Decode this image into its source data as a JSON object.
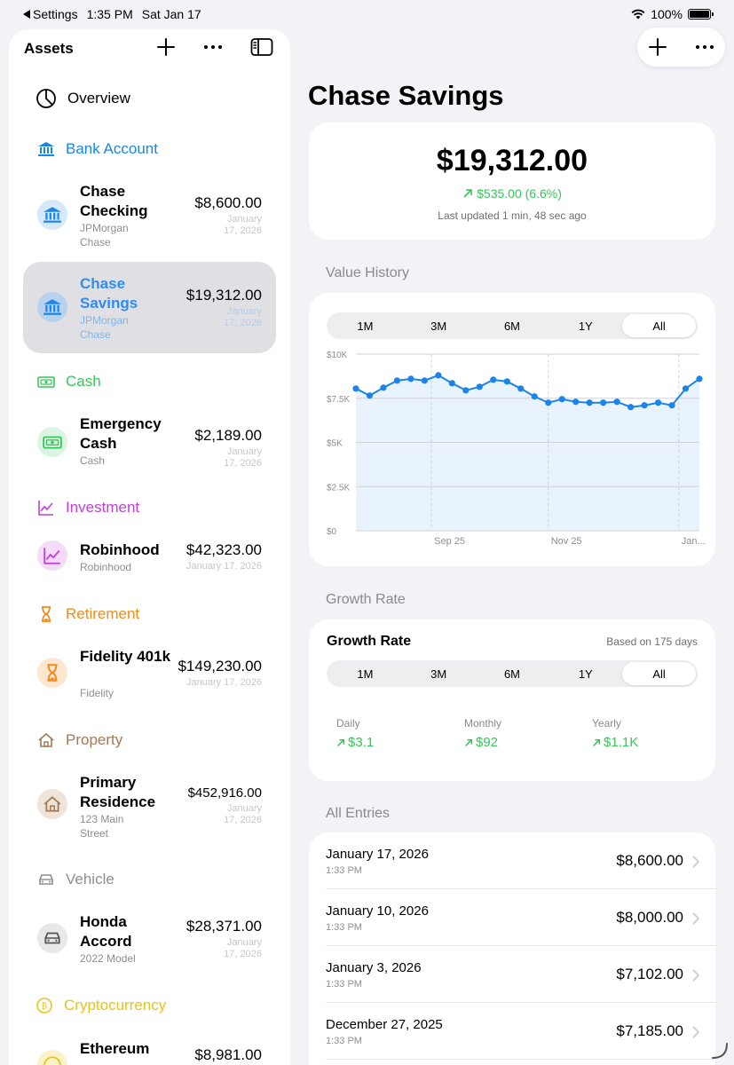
{
  "status": {
    "back_label": "Settings",
    "time": "1:35 PM",
    "date": "Sat Jan 17",
    "battery": "100%",
    "battery_level": 1.0
  },
  "sidebar": {
    "title": "Assets",
    "overview_label": "Overview",
    "sections": {
      "bank": {
        "label": "Bank Account",
        "color": "#1a84e8"
      },
      "cash": {
        "label": "Cash",
        "color": "#34c759"
      },
      "investment": {
        "label": "Investment",
        "color": "#c23fd9"
      },
      "retirement": {
        "label": "Retirement",
        "color": "#f08a1a"
      },
      "property": {
        "label": "Property",
        "color": "#a67953"
      },
      "vehicle": {
        "label": "Vehicle",
        "color": "#8e8e93"
      },
      "crypto": {
        "label": "Cryptocurrency",
        "color": "#e8c31a"
      }
    },
    "items": [
      {
        "name": "Chase Checking",
        "sub": "JPMorgan Chase",
        "amount": "$8,600.00",
        "date": "January 17, 2026"
      },
      {
        "name": "Chase Savings",
        "sub": "JPMorgan Chase",
        "amount": "$19,312.00",
        "date": "January 17, 2026"
      },
      {
        "name": "Emergency Cash",
        "sub": "Cash",
        "amount": "$2,189.00",
        "date": "January 17, 2026"
      },
      {
        "name": "Robinhood",
        "sub": "Robinhood",
        "amount": "$42,323.00",
        "date": "January 17, 2026"
      },
      {
        "name": "Fidelity 401k",
        "sub": "Fidelity",
        "amount": "$149,230.00",
        "date": "January 17, 2026"
      },
      {
        "name": "Primary Residence",
        "sub": "123 Main Street",
        "amount": "$452,916.00",
        "date": "January 17, 2026"
      },
      {
        "name": "Honda Accord",
        "sub": "2022 Model",
        "amount": "$28,371.00",
        "date": "January 17, 2026"
      },
      {
        "name": "Ethereum",
        "sub": "",
        "amount": "$8,981.00",
        "date": ""
      }
    ]
  },
  "main": {
    "title": "Chase Savings",
    "summary": {
      "amount": "$19,312.00",
      "change": "$535.00 (6.6%)",
      "updated": "Last updated 1 min, 48 sec ago"
    },
    "value_history_label": "Value History",
    "growth_rate_section_label": "Growth Rate",
    "all_entries_label": "All Entries",
    "ranges": [
      "1M",
      "3M",
      "6M",
      "1Y",
      "All"
    ],
    "active_range": "All",
    "growth": {
      "title": "Growth Rate",
      "based_on": "Based on 175 days",
      "daily_label": "Daily",
      "daily_value": "$3.1",
      "monthly_label": "Monthly",
      "monthly_value": "$92",
      "yearly_label": "Yearly",
      "yearly_value": "$1.1K"
    },
    "entries": [
      {
        "date": "January 17, 2026",
        "time": "1:33 PM",
        "amount": "$8,600.00"
      },
      {
        "date": "January 10, 2026",
        "time": "1:33 PM",
        "amount": "$8,000.00"
      },
      {
        "date": "January 3, 2026",
        "time": "1:33 PM",
        "amount": "$7,102.00"
      },
      {
        "date": "December 27, 2025",
        "time": "1:33 PM",
        "amount": "$7,185.00"
      }
    ]
  },
  "chart_data": {
    "type": "area",
    "x_tick_labels": [
      "Sep 25",
      "Nov 25",
      "Jan..."
    ],
    "y_tick_labels": [
      "$0",
      "$2.5K",
      "$5K",
      "$7.5K",
      "$10K"
    ],
    "y_ticks": [
      0,
      2500,
      5000,
      7500,
      10000
    ],
    "ylim": [
      0,
      10000
    ],
    "series": [
      {
        "values": [
          8050,
          7650,
          8100,
          8500,
          8600,
          8500,
          8800,
          8350,
          7950,
          8150,
          8550,
          8450,
          8050,
          7600,
          7250,
          7450,
          7300,
          7250,
          7250,
          7300,
          7000,
          7100,
          7250,
          7100,
          8050,
          8600
        ]
      }
    ],
    "line_color": "#1a84e8",
    "fill_color": "#e8f3fe",
    "grid": true
  }
}
